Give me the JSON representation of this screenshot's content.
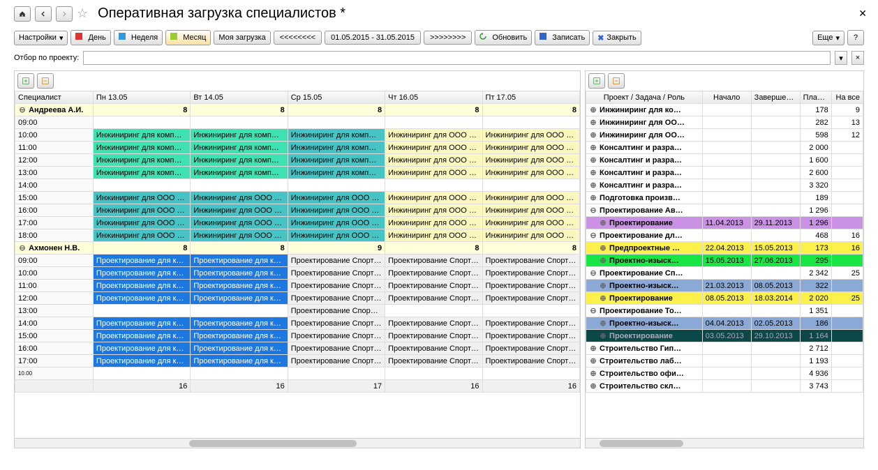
{
  "title": "Оперативная загрузка специалистов *",
  "toolbar": {
    "settings": "Настройки",
    "day": "День",
    "week": "Неделя",
    "month": "Месяц",
    "myLoad": "Моя загрузка",
    "prev": "<<<<<<<<",
    "period": "01.05.2015 - 31.05.2015",
    "next": ">>>>>>>>",
    "refresh": "Обновить",
    "save": "Записать",
    "close": "Закрыть",
    "more": "Еще"
  },
  "filterLabel": "Отбор по проекту:",
  "scheduleHeaders": {
    "spec": "Специалист",
    "days": [
      "Пн 13.05",
      "Вт 14.05",
      "Ср 15.05",
      "Чт 16.05",
      "Пт 17.05"
    ]
  },
  "specialists": [
    {
      "name": "Андреева А.И.",
      "totals": [
        "8",
        "8",
        "8",
        "8",
        "8"
      ],
      "hours": [
        "09:00",
        "10:00",
        "11:00",
        "12:00",
        "13:00",
        "14:00",
        "15:00",
        "16:00",
        "17:00",
        "18:00"
      ],
      "rows": [
        [
          null,
          null,
          null,
          null,
          null
        ],
        [
          {
            "t": "Инжиниринг для комп…",
            "c": "cell-green"
          },
          {
            "t": "Инжиниринг для комп…",
            "c": "cell-green"
          },
          {
            "t": "Инжиниринг для комп…",
            "c": "cell-teal"
          },
          {
            "t": "Инжиниринг для ООО \"…",
            "c": "cell-yellow"
          },
          {
            "t": "Инжиниринг для ООО \"…",
            "c": "cell-yellow"
          }
        ],
        [
          {
            "t": "Инжиниринг для комп…",
            "c": "cell-green"
          },
          {
            "t": "Инжиниринг для комп…",
            "c": "cell-green"
          },
          {
            "t": "Инжиниринг для комп…",
            "c": "cell-teal"
          },
          {
            "t": "Инжиниринг для ООО \"…",
            "c": "cell-yellow"
          },
          {
            "t": "Инжиниринг для ООО \"…",
            "c": "cell-yellow"
          }
        ],
        [
          {
            "t": "Инжиниринг для комп…",
            "c": "cell-green"
          },
          {
            "t": "Инжиниринг для комп…",
            "c": "cell-green"
          },
          {
            "t": "Инжиниринг для комп…",
            "c": "cell-teal"
          },
          {
            "t": "Инжиниринг для ООО \"…",
            "c": "cell-yellow"
          },
          {
            "t": "Инжиниринг для ООО \"…",
            "c": "cell-yellow"
          }
        ],
        [
          {
            "t": "Инжиниринг для комп…",
            "c": "cell-green"
          },
          {
            "t": "Инжиниринг для комп…",
            "c": "cell-green"
          },
          {
            "t": "Инжиниринг для комп…",
            "c": "cell-teal"
          },
          {
            "t": "Инжиниринг для ООО \"…",
            "c": "cell-yellow"
          },
          {
            "t": "Инжиниринг для ООО \"…",
            "c": "cell-yellow"
          }
        ],
        [
          null,
          null,
          null,
          null,
          null
        ],
        [
          {
            "t": "Инжиниринг для ООО …",
            "c": "cell-teal"
          },
          {
            "t": "Инжиниринг для ООО …",
            "c": "cell-teal"
          },
          {
            "t": "Инжиниринг для ООО …",
            "c": "cell-teal"
          },
          {
            "t": "Инжиниринг для ООО \"…",
            "c": "cell-yellow"
          },
          {
            "t": "Инжиниринг для ООО \"…",
            "c": "cell-yellow"
          }
        ],
        [
          {
            "t": "Инжиниринг для ООО …",
            "c": "cell-teal"
          },
          {
            "t": "Инжиниринг для ООО …",
            "c": "cell-teal"
          },
          {
            "t": "Инжиниринг для ООО …",
            "c": "cell-teal"
          },
          {
            "t": "Инжиниринг для ООО \"…",
            "c": "cell-yellow"
          },
          {
            "t": "Инжиниринг для ООО \"…",
            "c": "cell-yellow"
          }
        ],
        [
          {
            "t": "Инжиниринг для ООО …",
            "c": "cell-teal"
          },
          {
            "t": "Инжиниринг для ООО …",
            "c": "cell-teal"
          },
          {
            "t": "Инжиниринг для ООО …",
            "c": "cell-teal"
          },
          {
            "t": "Инжиниринг для ООО \"…",
            "c": "cell-yellow"
          },
          {
            "t": "Инжиниринг для ООО \"…",
            "c": "cell-yellow"
          }
        ],
        [
          {
            "t": "Инжиниринг для ООО …",
            "c": "cell-teal"
          },
          {
            "t": "Инжиниринг для ООО …",
            "c": "cell-teal"
          },
          {
            "t": "Инжиниринг для ООО …",
            "c": "cell-teal"
          },
          {
            "t": "Инжиниринг для ООО \"…",
            "c": "cell-yellow"
          },
          {
            "t": "Инжиниринг для ООО \"…",
            "c": "cell-yellow"
          }
        ]
      ]
    },
    {
      "name": "Ахмонен Н.В.",
      "totals": [
        "8",
        "8",
        "9",
        "8",
        "8"
      ],
      "hours": [
        "09:00",
        "10:00",
        "11:00",
        "12:00",
        "13:00",
        "14:00",
        "15:00",
        "16:00",
        "17:00"
      ],
      "rows": [
        [
          {
            "t": "Проектирование для к…",
            "c": "cell-blue"
          },
          {
            "t": "Проектирование для к…",
            "c": "cell-blue"
          },
          {
            "t": "Проектирование Спортк…",
            "c": "cell-grey"
          },
          {
            "t": "Проектирование Спортк…",
            "c": "cell-grey"
          },
          {
            "t": "Проектирование Спортк…",
            "c": "cell-grey"
          }
        ],
        [
          {
            "t": "Проектирование для к…",
            "c": "cell-blue"
          },
          {
            "t": "Проектирование для к…",
            "c": "cell-blue"
          },
          {
            "t": "Проектирование Спортк…",
            "c": "cell-grey"
          },
          {
            "t": "Проектирование Спортк…",
            "c": "cell-grey"
          },
          {
            "t": "Проектирование Спортк…",
            "c": "cell-grey"
          }
        ],
        [
          {
            "t": "Проектирование для к…",
            "c": "cell-blue"
          },
          {
            "t": "Проектирование для к…",
            "c": "cell-blue"
          },
          {
            "t": "Проектирование Спортк…",
            "c": "cell-grey"
          },
          {
            "t": "Проектирование Спортк…",
            "c": "cell-grey"
          },
          {
            "t": "Проектирование Спортк…",
            "c": "cell-grey"
          }
        ],
        [
          {
            "t": "Проектирование для к…",
            "c": "cell-blue"
          },
          {
            "t": "Проектирование для к…",
            "c": "cell-blue"
          },
          {
            "t": "Проектирование Спортк…",
            "c": "cell-grey"
          },
          {
            "t": "Проектирование Спортк…",
            "c": "cell-grey"
          },
          {
            "t": "Проектирование Спортк…",
            "c": "cell-grey"
          }
        ],
        [
          null,
          null,
          {
            "t": "Проектирование Спор…",
            "c": "cell-grey"
          },
          null,
          null
        ],
        [
          {
            "t": "Проектирование для к…",
            "c": "cell-blue"
          },
          {
            "t": "Проектирование для к…",
            "c": "cell-blue"
          },
          {
            "t": "Проектирование Спортк…",
            "c": "cell-grey"
          },
          {
            "t": "Проектирование Спортк…",
            "c": "cell-grey"
          },
          {
            "t": "Проектирование Спортк…",
            "c": "cell-grey"
          }
        ],
        [
          {
            "t": "Проектирование для к…",
            "c": "cell-blue"
          },
          {
            "t": "Проектирование для к…",
            "c": "cell-blue"
          },
          {
            "t": "Проектирование Спортк…",
            "c": "cell-grey"
          },
          {
            "t": "Проектирование Спортк…",
            "c": "cell-grey"
          },
          {
            "t": "Проектирование Спортк…",
            "c": "cell-grey"
          }
        ],
        [
          {
            "t": "Проектирование для к…",
            "c": "cell-blue"
          },
          {
            "t": "Проектирование для к…",
            "c": "cell-blue"
          },
          {
            "t": "Проектирование Спортк…",
            "c": "cell-grey"
          },
          {
            "t": "Проектирование Спортк…",
            "c": "cell-grey"
          },
          {
            "t": "Проектирование Спортк…",
            "c": "cell-grey"
          }
        ],
        [
          {
            "t": "Проектирование для к…",
            "c": "cell-blue"
          },
          {
            "t": "Проектирование для к…",
            "c": "cell-blue"
          },
          {
            "t": "Проектирование Спортк…",
            "c": "cell-grey"
          },
          {
            "t": "Проектирование Спортк…",
            "c": "cell-grey"
          },
          {
            "t": "Проектирование Спортк…",
            "c": "cell-grey"
          }
        ]
      ]
    }
  ],
  "footer": [
    "16",
    "16",
    "17",
    "16",
    "16"
  ],
  "rightHeaders": {
    "proj": "Проект / Задача / Роль",
    "start": "Начало",
    "end": "Завершение",
    "plan": "План всего",
    "na": "На все"
  },
  "rightRows": [
    {
      "exp": "⊕",
      "name": "Инжиниринг для ко…",
      "start": "",
      "end": "",
      "plan": "178",
      "na": "9",
      "bold": true
    },
    {
      "exp": "⊕",
      "name": "Инжиниринг для ОО…",
      "start": "",
      "end": "",
      "plan": "282",
      "na": "13",
      "bold": true
    },
    {
      "exp": "⊕",
      "name": "Инжиниринг для ОО…",
      "start": "",
      "end": "",
      "plan": "598",
      "na": "12",
      "bold": true
    },
    {
      "exp": "⊕",
      "name": "Консалтинг и разра…",
      "start": "",
      "end": "",
      "plan": "2 000",
      "na": "",
      "bold": true
    },
    {
      "exp": "⊕",
      "name": "Консалтинг и разра…",
      "start": "",
      "end": "",
      "plan": "1 600",
      "na": "",
      "bold": true
    },
    {
      "exp": "⊕",
      "name": "Консалтинг и разра…",
      "start": "",
      "end": "",
      "plan": "2 600",
      "na": "",
      "bold": true
    },
    {
      "exp": "⊕",
      "name": "Консалтинг и разра…",
      "start": "",
      "end": "",
      "plan": "3 320",
      "na": "",
      "bold": true
    },
    {
      "exp": "⊕",
      "name": "Подготовка произв…",
      "start": "",
      "end": "",
      "plan": "189",
      "na": "",
      "bold": true
    },
    {
      "exp": "⊖",
      "name": "Проектирование Ав…",
      "start": "",
      "end": "",
      "plan": "1 296",
      "na": "",
      "bold": true
    },
    {
      "exp": "⊕",
      "name": "Проектирование",
      "start": "11.04.2013",
      "end": "29.11.2013",
      "plan": "1 296",
      "na": "",
      "bold": true,
      "bg": "bg-purple",
      "indent": true
    },
    {
      "exp": "⊖",
      "name": "Проектирование дл…",
      "start": "",
      "end": "",
      "plan": "468",
      "na": "16",
      "bold": true
    },
    {
      "exp": "⊕",
      "name": "Предпроектные …",
      "start": "22.04.2013",
      "end": "15.05.2013",
      "plan": "173",
      "na": "16",
      "bold": true,
      "bg": "bg-yellow2",
      "indent": true
    },
    {
      "exp": "⊕",
      "name": "Проектно-изыск…",
      "start": "15.05.2013",
      "end": "27.06.2013",
      "plan": "295",
      "na": "",
      "bold": true,
      "bg": "bg-green2",
      "indent": true
    },
    {
      "exp": "⊖",
      "name": "Проектирование Сп…",
      "start": "",
      "end": "",
      "plan": "2 342",
      "na": "25",
      "bold": true
    },
    {
      "exp": "⊕",
      "name": "Проектно-изыск…",
      "start": "21.03.2013",
      "end": "08.05.2013",
      "plan": "322",
      "na": "",
      "bold": true,
      "bg": "bg-bluegrey",
      "indent": true
    },
    {
      "exp": "⊕",
      "name": "Проектирование",
      "start": "08.05.2013",
      "end": "18.03.2014",
      "plan": "2 020",
      "na": "25",
      "bold": true,
      "bg": "bg-yellow2",
      "indent": true
    },
    {
      "exp": "⊖",
      "name": "Проектирование То…",
      "start": "",
      "end": "",
      "plan": "1 351",
      "na": "",
      "bold": true
    },
    {
      "exp": "⊕",
      "name": "Проектно-изыск…",
      "start": "04.04.2013",
      "end": "02.05.2013",
      "plan": "186",
      "na": "",
      "bold": true,
      "bg": "bg-bluegrey",
      "indent": true
    },
    {
      "exp": "⊕",
      "name": "Проектирование",
      "start": "03.05.2013",
      "end": "29.10.2013",
      "plan": "1 164",
      "na": "",
      "bold": true,
      "bg": "bg-darkteal",
      "indent": true
    },
    {
      "exp": "⊕",
      "name": "Строительство Гип…",
      "start": "",
      "end": "",
      "plan": "2 712",
      "na": "",
      "bold": true
    },
    {
      "exp": "⊕",
      "name": "Строительство лаб…",
      "start": "",
      "end": "",
      "plan": "1 193",
      "na": "",
      "bold": true
    },
    {
      "exp": "⊕",
      "name": "Строительство офи…",
      "start": "",
      "end": "",
      "plan": "4 936",
      "na": "",
      "bold": true
    },
    {
      "exp": "⊕",
      "name": "Строительство скл…",
      "start": "",
      "end": "",
      "plan": "3 743",
      "na": "",
      "bold": true
    }
  ]
}
